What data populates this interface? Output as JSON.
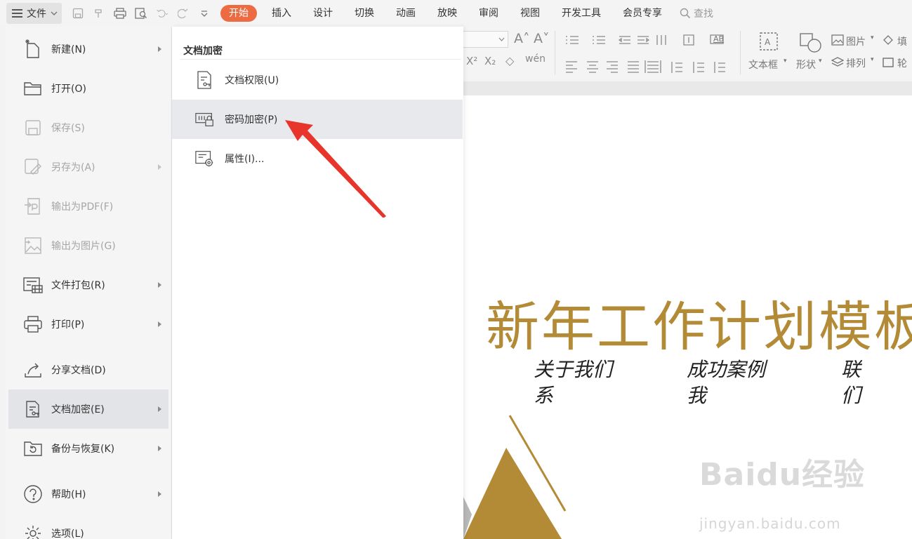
{
  "topbar": {
    "file_label": "文件",
    "tabs": [
      "开始",
      "插入",
      "设计",
      "切换",
      "动画",
      "放映",
      "审阅",
      "视图",
      "开发工具",
      "会员专享"
    ],
    "search_label": "查找"
  },
  "ribbon": {
    "textbox_label": "文本框",
    "shape_label": "形状",
    "picture_label": "图片",
    "arrange_label": "排列",
    "fill_label": "填",
    "outline_label": "轮",
    "ab_label": "AB"
  },
  "file_menu": {
    "items": [
      {
        "label": "新建(N)",
        "icon": "new-doc-icon",
        "disabled": false,
        "has_sub": true
      },
      {
        "label": "打开(O)",
        "icon": "folder-icon",
        "disabled": false,
        "has_sub": false
      },
      {
        "label": "保存(S)",
        "icon": "save-icon",
        "disabled": true,
        "has_sub": false
      },
      {
        "label": "另存为(A)",
        "icon": "save-as-icon",
        "disabled": true,
        "has_sub": true
      },
      {
        "label": "输出为PDF(F)",
        "icon": "export-pdf-icon",
        "disabled": true,
        "has_sub": false
      },
      {
        "label": "输出为图片(G)",
        "icon": "export-image-icon",
        "disabled": true,
        "has_sub": false
      },
      {
        "label": "文件打包(R)",
        "icon": "package-icon",
        "disabled": false,
        "has_sub": true
      },
      {
        "label": "打印(P)",
        "icon": "print-icon",
        "disabled": false,
        "has_sub": true
      },
      {
        "label": "分享文档(D)",
        "icon": "share-icon",
        "disabled": false,
        "has_sub": false
      },
      {
        "label": "文档加密(E)",
        "icon": "encrypt-doc-icon",
        "disabled": false,
        "has_sub": true
      },
      {
        "label": "备份与恢复(K)",
        "icon": "backup-icon",
        "disabled": false,
        "has_sub": true
      },
      {
        "label": "帮助(H)",
        "icon": "help-icon",
        "disabled": false,
        "has_sub": true
      },
      {
        "label": "选项(L)",
        "icon": "gear-icon",
        "disabled": false,
        "has_sub": false
      }
    ]
  },
  "submenu": {
    "title": "文档加密",
    "items": [
      {
        "label": "文档权限(U)",
        "icon": "doc-permission-icon"
      },
      {
        "label": "密码加密(P)",
        "icon": "password-lock-icon"
      },
      {
        "label": "属性(I)...",
        "icon": "properties-icon"
      }
    ]
  },
  "slide": {
    "title": "新年工作计划模板",
    "nav": [
      "关于我们系",
      "成功案例我",
      "联们"
    ]
  },
  "watermark": {
    "text": "Baidu经验",
    "sub": "jingyan.baidu.com"
  },
  "colors": {
    "active_tab": "#ec6b43",
    "slide_gold": "#b38a36",
    "arrow_red": "#e8352b"
  }
}
